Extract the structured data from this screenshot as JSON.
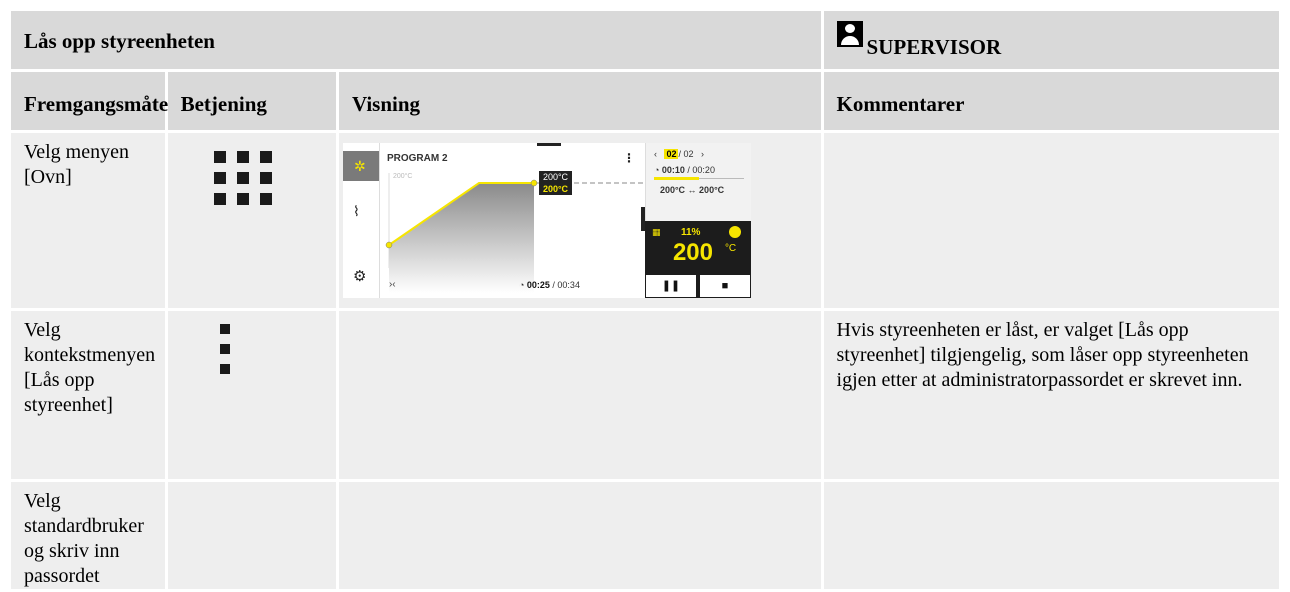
{
  "header": {
    "title": "Lås opp styreenheten",
    "role": "SUPERVISOR",
    "role_icon": "user-icon"
  },
  "columns": [
    "Fremgangsmåte",
    "Betjening",
    "Visning",
    "Kommentarer"
  ],
  "rows": [
    {
      "procedure": "Velg menyen [Ovn]",
      "operation_icon": "grid-menu-icon",
      "comment": ""
    },
    {
      "procedure": "Velg kontekstmenyen [Lås opp styreenhet]",
      "operation_icon": "kebab-menu-icon",
      "comment": "Hvis styreenheten er låst, er valget [Lås opp styreenhet] tilgjengelig, som låser opp styreenheten igjen etter at administratorpassordet er skrevet inn."
    },
    {
      "procedure": "Velg standardbruker og skriv inn passordet",
      "operation_icon": "",
      "comment": ""
    }
  ],
  "display": {
    "program": "PROGRAM 2",
    "chart_label": "200°C",
    "tag_set": "200°C",
    "tag_actual": "200°C",
    "segment_current": "02",
    "segment_total": "/ 02",
    "segment_time": "00:10",
    "segment_time_total": "/ 00:20",
    "range": "200°C ↔ 200°C",
    "power": "11%",
    "temperature": "200",
    "temperature_unit": "°C",
    "total_time": "00:25",
    "total_time_total": "/ 00:34",
    "accent_color": "#f6e500",
    "segment_progress": 0.5
  }
}
